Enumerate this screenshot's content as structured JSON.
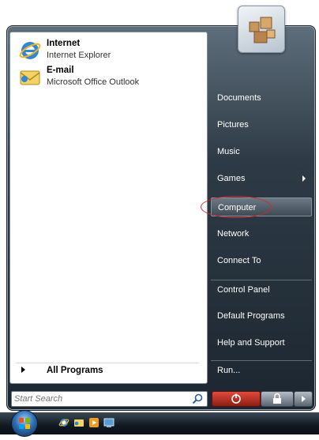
{
  "start_menu": {
    "pinned": [
      {
        "title": "Internet",
        "subtitle": "Internet Explorer",
        "icon": "internet-explorer-icon"
      },
      {
        "title": "E-mail",
        "subtitle": "Microsoft Office Outlook",
        "icon": "outlook-icon"
      }
    ],
    "all_programs_label": "All Programs",
    "search_placeholder": "Start Search",
    "right_items": [
      {
        "label": "Documents"
      },
      {
        "label": "Pictures"
      },
      {
        "label": "Music"
      },
      {
        "label": "Games"
      },
      {
        "label": "Computer"
      },
      {
        "label": "Network"
      },
      {
        "label": "Connect To"
      },
      {
        "label": "Control Panel"
      },
      {
        "label": "Default Programs"
      },
      {
        "label": "Help and Support"
      },
      {
        "label": "Run..."
      }
    ],
    "highlighted_item": "Computer",
    "annotation_color": "#d12a2a"
  },
  "taskbar": {
    "quick_launch_icons": [
      "internet-explorer-icon",
      "outlook-icon",
      "media-icon",
      "desktop-icon"
    ]
  }
}
